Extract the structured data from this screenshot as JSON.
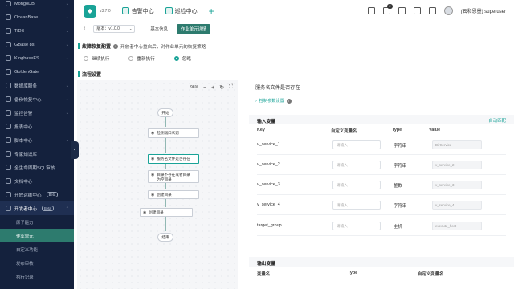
{
  "sidebar": {
    "items": [
      {
        "label": "MongoDB"
      },
      {
        "label": "OceanBase"
      },
      {
        "label": "TiDB"
      },
      {
        "label": "GBase 8s"
      },
      {
        "label": "KingbaseES"
      },
      {
        "label": "GoldenGate"
      },
      {
        "label": "数据库服务"
      },
      {
        "label": "备份恢复中心"
      },
      {
        "label": "监控告警"
      },
      {
        "label": "报表中心"
      },
      {
        "label": "脚本中心"
      },
      {
        "label": "专家知识库"
      },
      {
        "label": "全生命周期SQL审核"
      },
      {
        "label": "文档中心"
      },
      {
        "label": "开放运维中心",
        "badge": "Beta"
      },
      {
        "label": "开发者中心",
        "badge": "Beta"
      }
    ],
    "sub_items": [
      "原子能力",
      "作业单元",
      "自定义功能",
      "发布审核",
      "执行记录"
    ]
  },
  "topbar": {
    "version": "v3.7.0",
    "nav": [
      "告警中心",
      "巡检中心"
    ],
    "notification_count": "2",
    "user": "(云和恩墨) superuser"
  },
  "subbar": {
    "version_select": "版本：v1.0.0",
    "tabs": [
      "基本信息",
      "作业单元详情"
    ]
  },
  "recovery": {
    "title": "故障恢复配置",
    "hint": "开放者中心重启后，对作业单元的恢复策略",
    "options": [
      "继续执行",
      "重新执行",
      "忽略"
    ]
  },
  "flow": {
    "title": "流程设置",
    "zoom": "96%",
    "nodes": [
      "开始",
      "检测端口状态",
      "服务名文件是否存在",
      "目录不存在或者目录为空目录",
      "创建目录",
      "创建目录",
      "结束"
    ]
  },
  "panel": {
    "heading": "服务名文件是否存在",
    "advanced": "控制参数设置",
    "input_title": "输入变量",
    "auto_match": "自动匹配",
    "input_headers": [
      "Key",
      "自定义变量名",
      "Type",
      "Value"
    ],
    "input_rows": [
      {
        "key": "v_service_1",
        "placeholder": "请输入",
        "type": "字符串",
        "value": "DirService"
      },
      {
        "key": "v_service_2",
        "placeholder": "请输入",
        "type": "字符串",
        "value": "v_service_2"
      },
      {
        "key": "v_service_3",
        "placeholder": "请输入",
        "type": "整数",
        "value": "v_service_3"
      },
      {
        "key": "v_service_4",
        "placeholder": "请输入",
        "type": "字符串",
        "value": "v_service_4"
      },
      {
        "key": "target_group",
        "placeholder": "请输入",
        "type": "主机",
        "value": "execute_host"
      }
    ],
    "output_title": "输出变量",
    "output_headers": [
      "变量名",
      "Type",
      "自定义变量名"
    ]
  },
  "colors": {
    "accent": "#19a397",
    "sidebar_bg": "#14213d",
    "active_sub": "#2d7b6e"
  }
}
